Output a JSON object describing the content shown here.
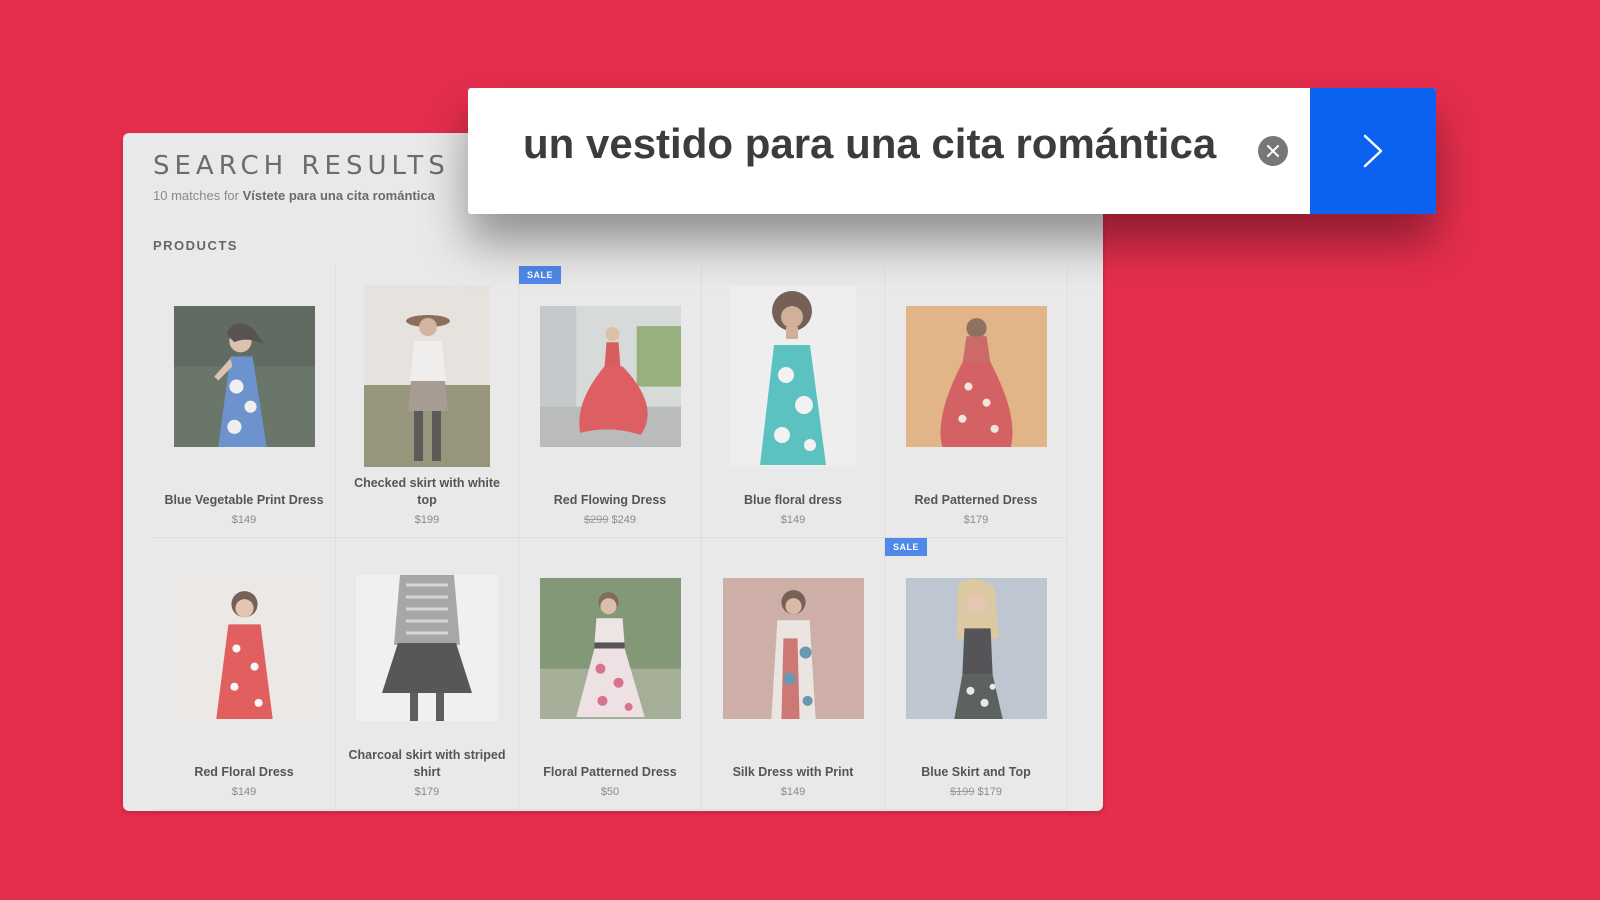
{
  "search": {
    "query": "un vestido para una cita romántica"
  },
  "results": {
    "title": "SEARCH RESULTS",
    "count_text": "10 matches for",
    "original_query": "Vístete para una cita romántica",
    "section_label": "PRODUCTS"
  },
  "products": [
    {
      "name": "Blue Vegetable Print Dress",
      "price": "$149",
      "old_price": "",
      "badge": ""
    },
    {
      "name": "Checked skirt with white top",
      "price": "$199",
      "old_price": "",
      "badge": ""
    },
    {
      "name": "Red Flowing Dress",
      "price": "$249",
      "old_price": "$299",
      "badge": "SALE"
    },
    {
      "name": "Blue floral dress",
      "price": "$149",
      "old_price": "",
      "badge": ""
    },
    {
      "name": "Red Patterned Dress",
      "price": "$179",
      "old_price": "",
      "badge": ""
    },
    {
      "name": "Red Floral Dress",
      "price": "$149",
      "old_price": "",
      "badge": ""
    },
    {
      "name": "Charcoal skirt with striped shirt",
      "price": "$179",
      "old_price": "",
      "badge": ""
    },
    {
      "name": "Floral Patterned Dress",
      "price": "$50",
      "old_price": "",
      "badge": ""
    },
    {
      "name": "Silk Dress with Print",
      "price": "$149",
      "old_price": "",
      "badge": ""
    },
    {
      "name": "Blue Skirt and Top",
      "price": "$179",
      "old_price": "$199",
      "badge": "SALE"
    }
  ],
  "colors": {
    "background": "#e52e4d",
    "accent": "#0b61f0",
    "badge": "#3f7ee8"
  },
  "icons": {
    "clear": "close-icon",
    "submit": "chevron-right-icon"
  }
}
